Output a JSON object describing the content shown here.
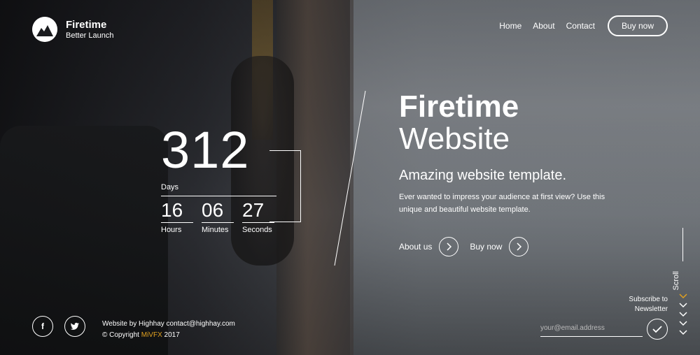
{
  "logo": {
    "title": "Firetime",
    "subtitle": "Better Launch"
  },
  "nav": {
    "items": [
      {
        "label": "Home"
      },
      {
        "label": "About"
      },
      {
        "label": "Contact"
      }
    ],
    "buy_label": "Buy now"
  },
  "countdown": {
    "days": "312",
    "days_label": "Days",
    "hours": "16",
    "hours_label": "Hours",
    "minutes": "06",
    "minutes_label": "Minutes",
    "seconds": "27",
    "seconds_label": "Seconds"
  },
  "hero": {
    "title": "Firetime",
    "title2": "Website",
    "subtitle": "Amazing website template.",
    "description": "Ever wanted to impress your audience at first view? Use this unique and beautiful website template.",
    "about_label": "About us",
    "buy_label": "Buy now"
  },
  "scroll": {
    "label": "Scroll",
    "accent_color": "#e0a020"
  },
  "newsletter": {
    "label_line1": "Subscribe to",
    "label_line2": "Newsletter",
    "placeholder": "your@email.address"
  },
  "footer": {
    "line1": "Website by Highhay contact@highhay.com",
    "copyright_prefix": "© Copyright ",
    "brand": "MiVFX",
    "year": " 2017",
    "social": [
      {
        "icon": "facebook-icon",
        "glyph": "f"
      },
      {
        "icon": "twitter-icon",
        "glyph": "t"
      }
    ]
  }
}
